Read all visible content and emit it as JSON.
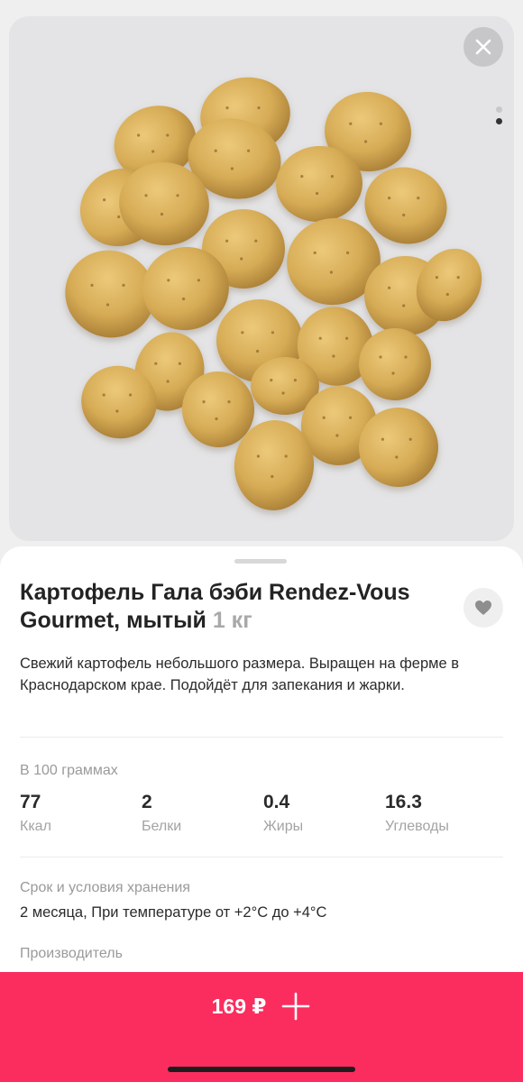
{
  "product": {
    "title": "Картофель Гала бэби Rendez-Vous Gourmet, мытый",
    "weight": "1 кг",
    "description": "Свежий картофель небольшого размера. Выращен на ферме в Краснодарском крае. Подойдёт для запекания и жарки."
  },
  "nutrition": {
    "heading": "В 100 граммах",
    "items": [
      {
        "value": "77",
        "label": "Ккал"
      },
      {
        "value": "2",
        "label": "Белки"
      },
      {
        "value": "0.4",
        "label": "Жиры"
      },
      {
        "value": "16.3",
        "label": "Углеводы"
      }
    ]
  },
  "storage": {
    "heading": "Срок и условия хранения",
    "value": "2 месяца, При температуре от +2°C до +4°C"
  },
  "manufacturer": {
    "heading": "Производитель"
  },
  "cart": {
    "price": "169 ₽"
  },
  "icons": {
    "close": "close-icon",
    "favorite": "heart-icon",
    "add": "plus-icon"
  },
  "colors": {
    "accent": "#fb2d5e",
    "potato": "#d9b15c"
  }
}
